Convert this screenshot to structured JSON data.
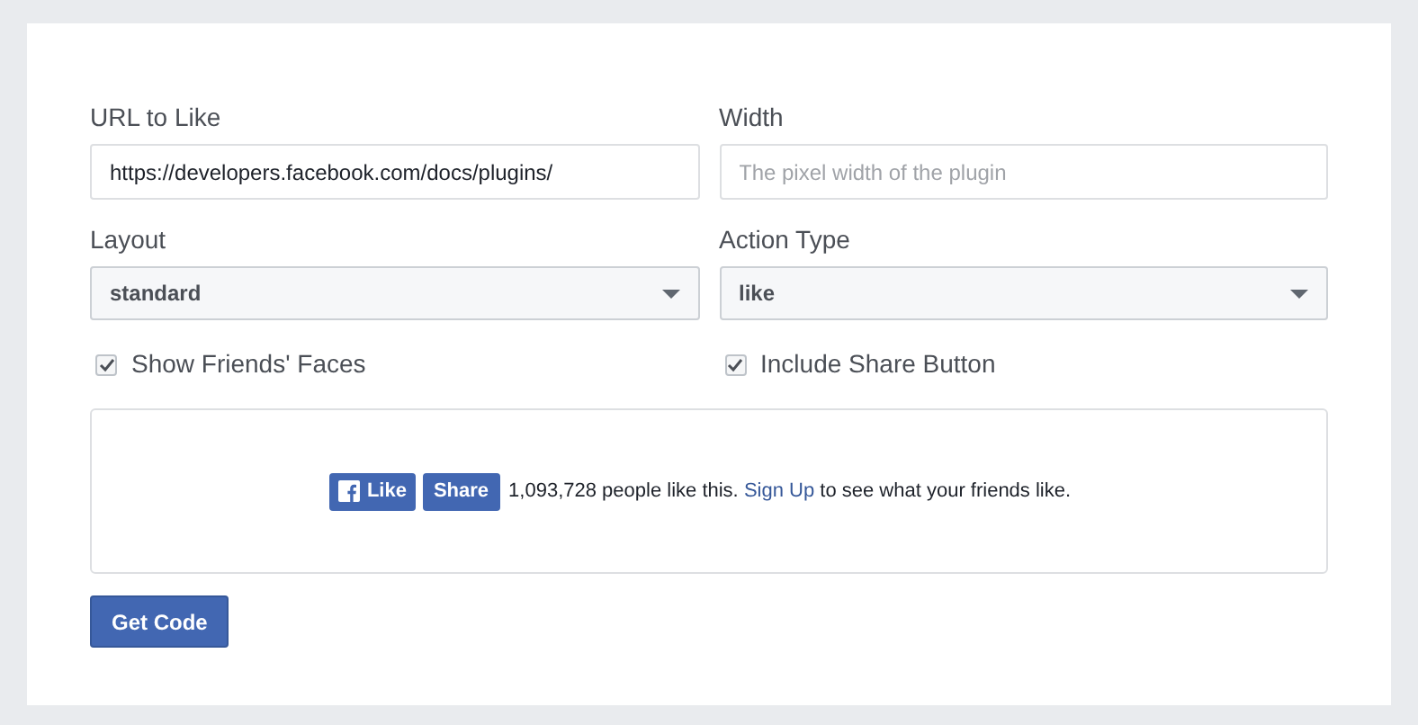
{
  "fields": [
    {
      "kind": "text",
      "label": "URL to Like",
      "value": "https://developers.facebook.com/docs/plugins/"
    },
    {
      "kind": "text",
      "label": "Width",
      "placeholder": "The pixel width of the plugin"
    },
    {
      "kind": "select",
      "label": "Layout",
      "value": "standard"
    },
    {
      "kind": "select",
      "label": "Action Type",
      "value": "like"
    }
  ],
  "options": [
    {
      "label": "Show Friends' Faces",
      "checked": true
    },
    {
      "label": "Include Share Button",
      "checked": true
    }
  ],
  "preview": {
    "like_button": "Like",
    "share_button": "Share",
    "text_before": "1,093,728 people like this.",
    "link": "Sign Up",
    "text_after": "to see what your friends like."
  },
  "get_code_button": "Get Code"
}
